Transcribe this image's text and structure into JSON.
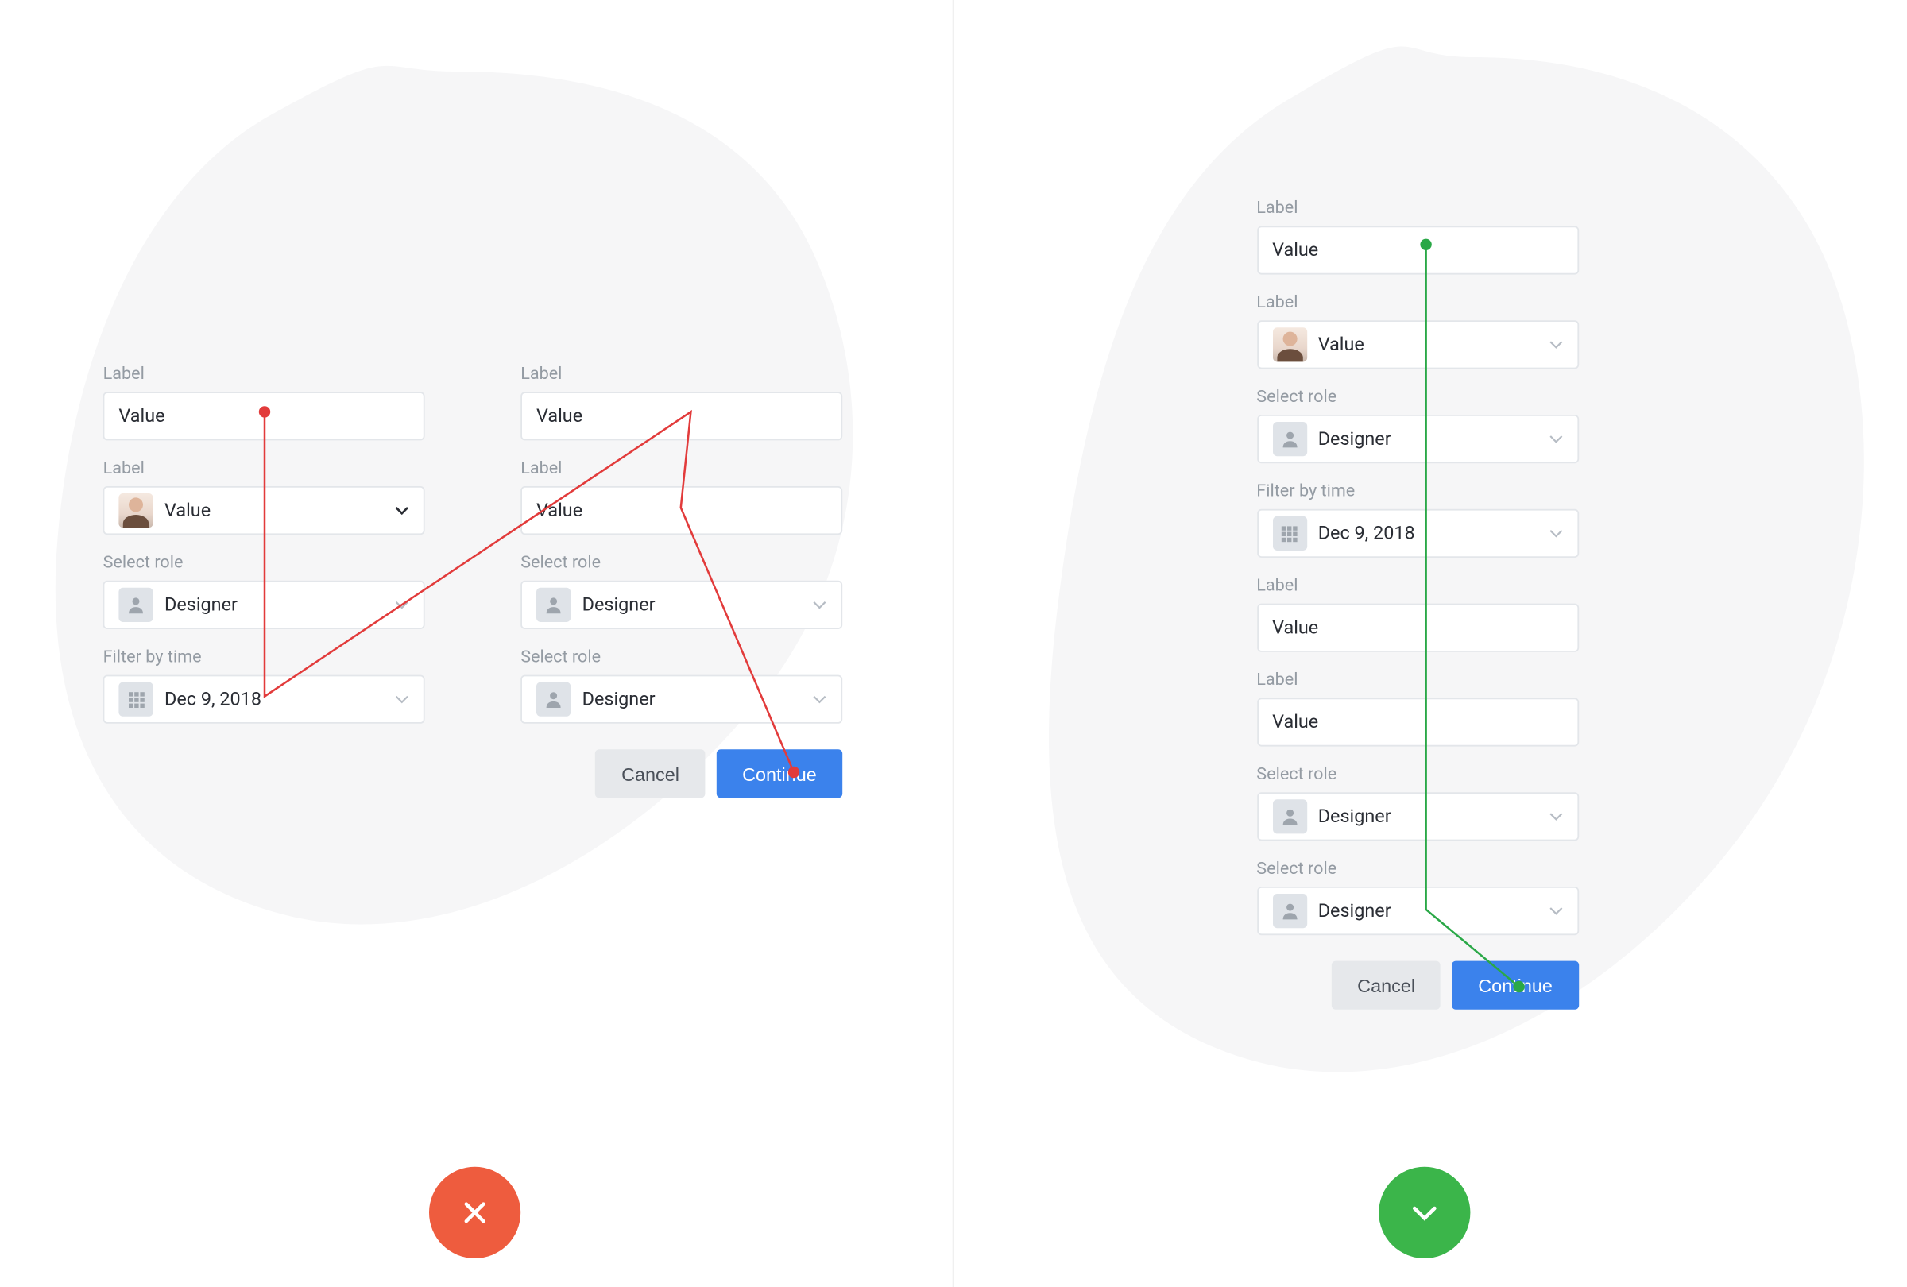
{
  "colors": {
    "primary": "#3b82ec",
    "danger": "#ee5c3e",
    "success": "#3bb54a"
  },
  "buttons": {
    "cancel": "Cancel",
    "continue": "Continue"
  },
  "left": {
    "colA": {
      "g1": {
        "label": "Label",
        "value": "Value"
      },
      "g2": {
        "label": "Label",
        "value": "Value"
      },
      "g3": {
        "label": "Select role",
        "value": "Designer"
      },
      "g4": {
        "label": "Filter by time",
        "value": "Dec 9, 2018"
      }
    },
    "colB": {
      "g1": {
        "label": "Label",
        "value": "Value"
      },
      "g2": {
        "label": "Label",
        "value": "Value"
      },
      "g3": {
        "label": "Select role",
        "value": "Designer"
      },
      "g4": {
        "label": "Select role",
        "value": "Designer"
      }
    }
  },
  "right": {
    "g1": {
      "label": "Label",
      "value": "Value"
    },
    "g2": {
      "label": "Label",
      "value": "Value"
    },
    "g3": {
      "label": "Select role",
      "value": "Designer"
    },
    "g4": {
      "label": "Filter by time",
      "value": "Dec 9, 2018"
    },
    "g5": {
      "label": "Label",
      "value": "Value"
    },
    "g6": {
      "label": "Label",
      "value": "Value"
    },
    "g7": {
      "label": "Select role",
      "value": "Designer"
    },
    "g8": {
      "label": "Select role",
      "value": "Designer"
    }
  }
}
